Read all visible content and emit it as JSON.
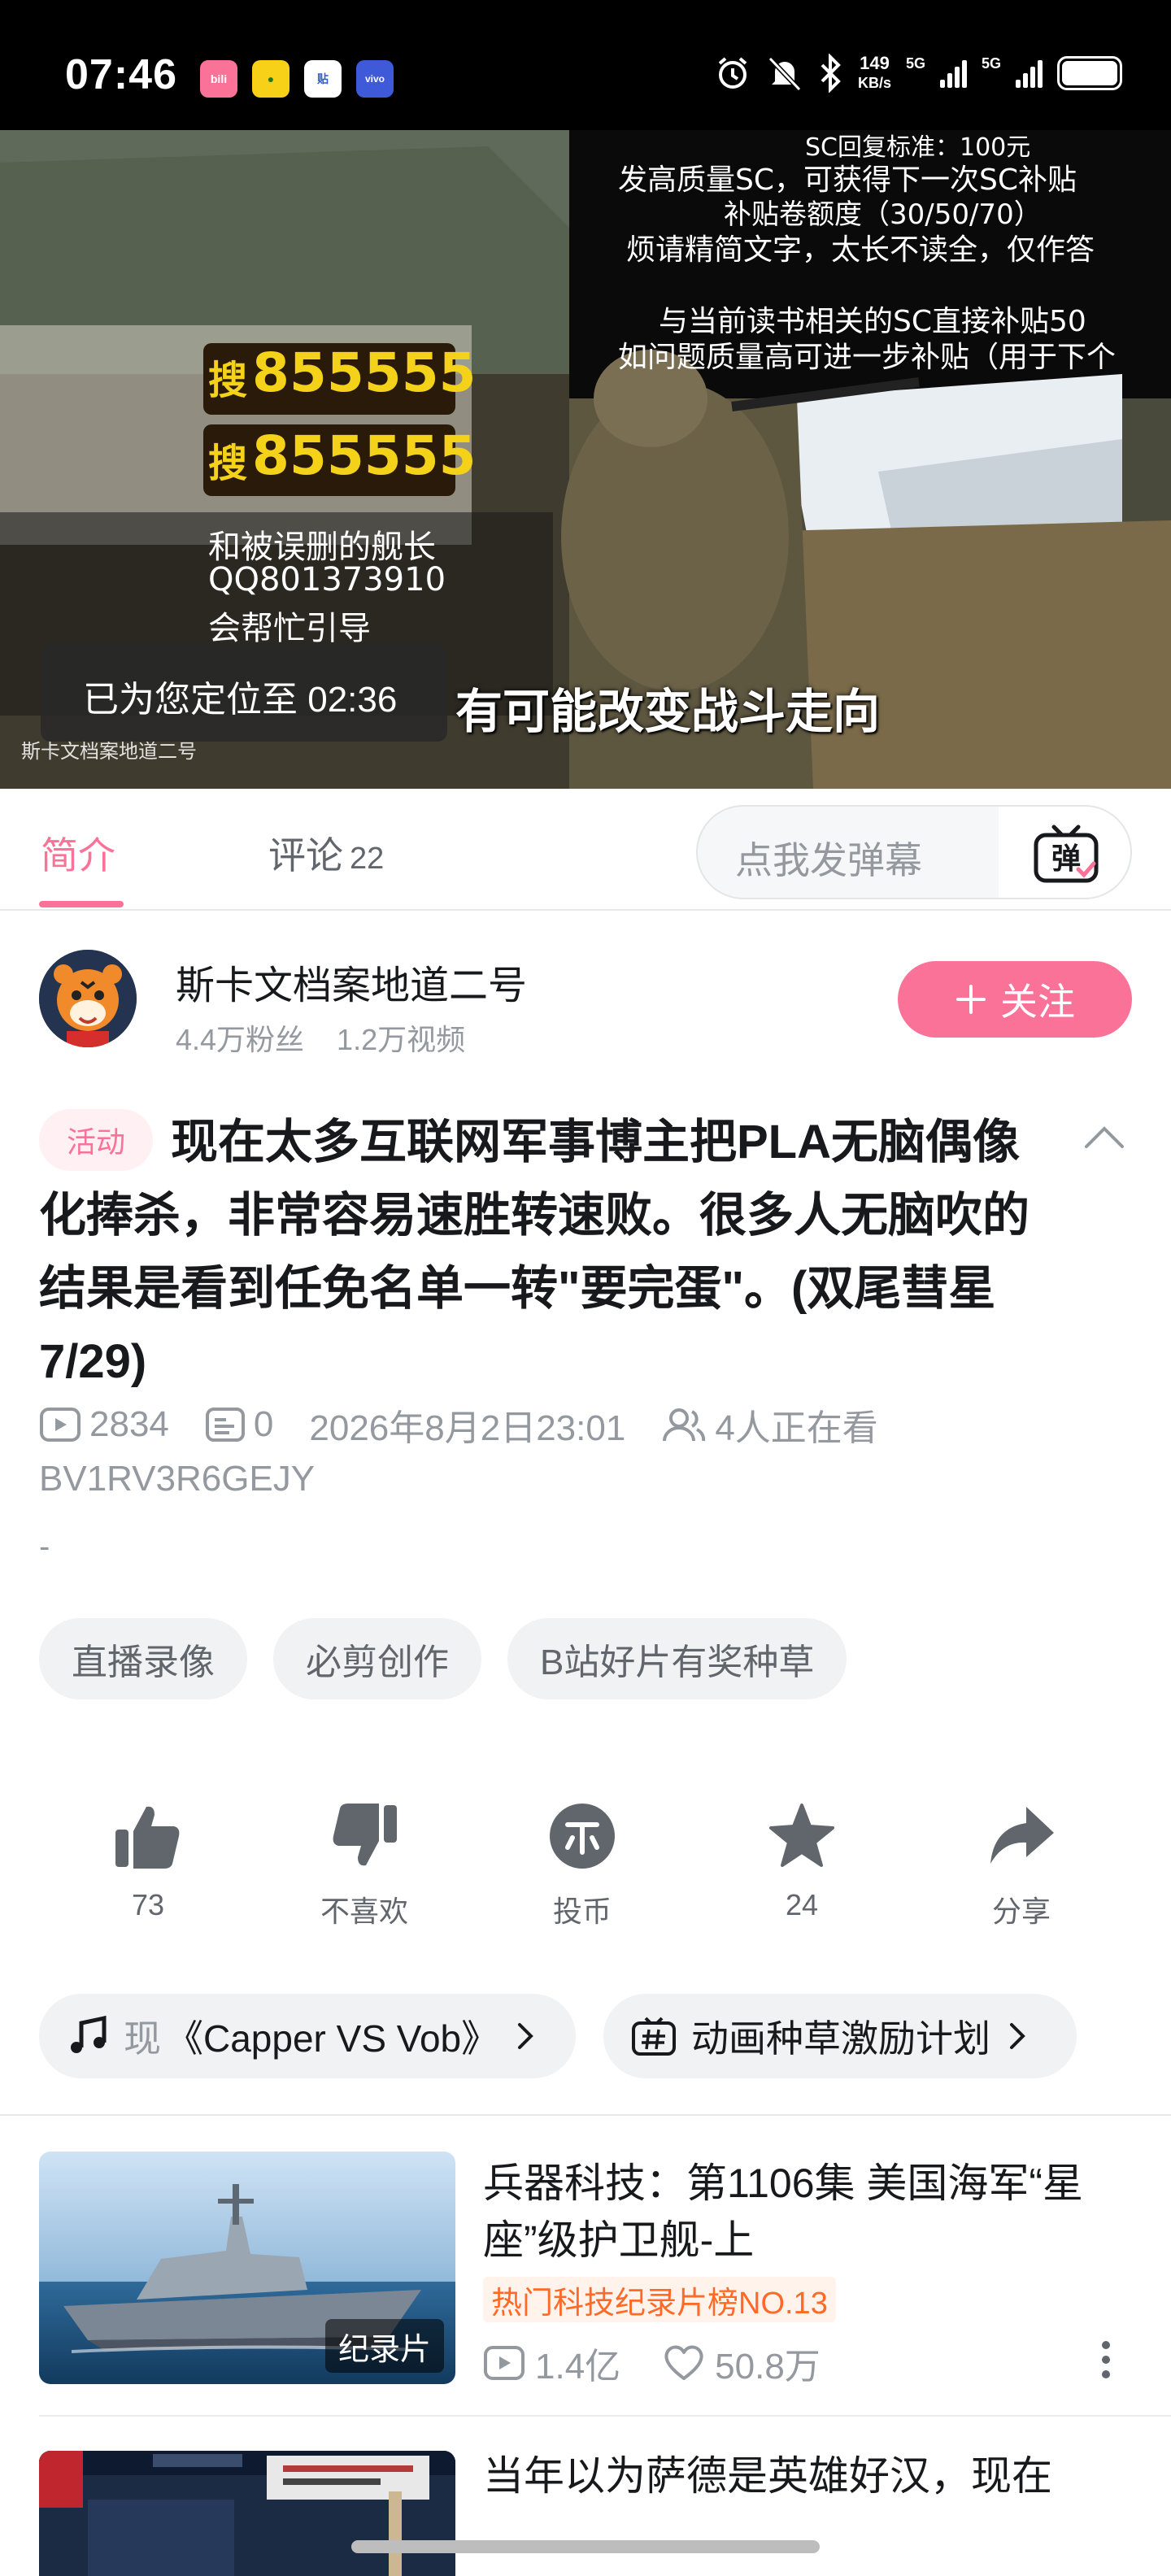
{
  "status_bar": {
    "time": "07:46",
    "apps": [
      "bilibili",
      "app-2",
      "贴",
      "vivo"
    ],
    "net_speed": "149",
    "net_unit": "KB/s",
    "signal_1": "5G",
    "signal_2": "5G",
    "battery_level": 1.0
  },
  "video": {
    "overlay_lines": [
      "SC回复标准：100元",
      "发高质量SC，可获得下一次SC补贴",
      "补贴卷额度（30/50/70）",
      "烦请精简文字，太长不读全，仅作答",
      "与当前读书相关的SC直接补贴50",
      "如问题质量高可进一步补贴（用于下个"
    ],
    "promo_1_prefix": "搜",
    "promo_1_number": "855555",
    "promo_2_prefix": "搜",
    "promo_2_number": "855555",
    "promo_lines": [
      "和被误删的舰长",
      "QQ801373910",
      "会帮忙引导"
    ],
    "watermark": "斯卡文档案地道二号",
    "resume_toast": "已为您定位至 02:36",
    "subtitle": "有可能改变战斗走向",
    "progress": 0.18
  },
  "tabs": {
    "intro": "简介",
    "comments": "评论",
    "comments_count": "22",
    "danmaku_placeholder": "点我发弹幕",
    "danmaku_button": "弹"
  },
  "uploader": {
    "name": "斯卡文档案地道二号",
    "fans": "4.4万粉丝",
    "videos": "1.2万视频",
    "follow_label": "关注"
  },
  "video_info": {
    "badge": "活动",
    "title": "现在太多互联网军事博主把PLA无脑偶像化捧杀，非常容易速胜转速败。很多人无脑吹的结果是看到任免名单一转\"要完蛋\"。(双尾彗星7/29)",
    "plays": "2834",
    "danmaku": "0",
    "date": "2026年8月2日23:01",
    "watching": "4人正在看",
    "bvid": "BV1RV3R6GEJY",
    "desc": "-"
  },
  "tags": [
    "直播录像",
    "必剪创作",
    "B站好片有奖种草"
  ],
  "actions": {
    "like": "73",
    "dislike": "不喜欢",
    "coin": "投币",
    "favorite": "24",
    "share": "分享"
  },
  "chips": {
    "music_faded": "现",
    "music": "《Capper VS Vob》",
    "activity": "动画种草激励计划"
  },
  "related": [
    {
      "title": "兵器科技：第1106集 美国海军“星座”级护卫舰-上",
      "thumb_tag": "纪录片",
      "rank": "热门科技纪录片榜NO.13",
      "plays": "1.4亿",
      "likes": "50.8万"
    },
    {
      "title": "当年以为萨德是英雄好汉，现在"
    }
  ],
  "colors": {
    "accent": "#fb7299",
    "rank": "#ff6a28",
    "muted": "#9499a0"
  }
}
